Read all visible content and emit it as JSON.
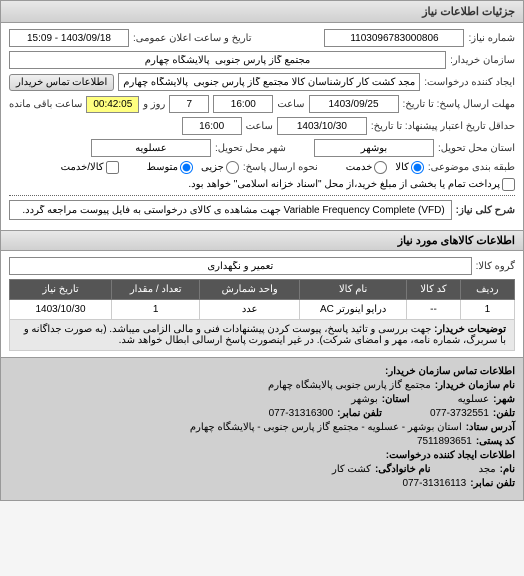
{
  "header": {
    "title": "جزئیات اطلاعات نیاز"
  },
  "fields": {
    "request_no_label": "شماره نیاز:",
    "request_no": "1103096783000806",
    "pub_date_label": "تاریخ و ساعت اعلان عمومی:",
    "pub_date": "1403/09/18 - 15:09",
    "buyer_org_label": "سازمان خریدار:",
    "buyer_org": "مجتمع گاز پارس جنوبی  پالایشگاه چهارم",
    "creator_label": "ایجاد کننده درخواست:",
    "creator": "مجد کشت کار کارشناسان کالا مجتمع گاز پارس جنوبی  پالایشگاه چهارم",
    "contact_btn": "اطلاعات تماس خریدار",
    "deadline_label": "مهلت ارسال پاسخ: تا تاریخ:",
    "deadline_date": "1403/09/25",
    "time_label": "ساعت",
    "deadline_time": "16:00",
    "days_remain": "7",
    "days_label": "روز و",
    "time_remain": "00:42:05",
    "remain_label": "ساعت باقی مانده",
    "validity_label": "حداقل تاریخ اعتبار پیشنهاد: تا تاریخ:",
    "validity_date": "1403/10/30",
    "validity_time": "16:00",
    "delivery_state_label": "استان محل تحویل:",
    "delivery_state": "بوشهر",
    "delivery_city_label": "شهر محل تحویل:",
    "delivery_city": "عسلویه",
    "budget_label": "طبقه بندی موضوعی:",
    "radio_goods": "کالا",
    "radio_service": "خدمت",
    "reply_method_label": "نحوه ارسال پاسخ:",
    "radio_normal": "متوسط",
    "radio_partial": "جزیی",
    "sms_checkbox": "کالا/خدمت",
    "credit_note": "پرداخت تمام یا بخشی از مبلغ خرید،از محل \"اسناد خزانه اسلامی\" خواهد بود.",
    "desc_label": "شرح کلی نیاز:",
    "desc": "Variable Frequency Complete (VFD) جهت مشاهده ی کالای درخواستی به فایل پیوست مراجعه گردد."
  },
  "goods_section": {
    "title": "اطلاعات کالاهای مورد نیاز",
    "group_label": "گروه کالا:",
    "group": "تعمیر و نگهداری"
  },
  "table": {
    "headers": [
      "ردیف",
      "کد کالا",
      "نام کالا",
      "واحد شمارش",
      "تعداد / مقدار",
      "تاریخ نیاز"
    ],
    "rows": [
      {
        "row": "1",
        "code": "--",
        "name": "درایو اینورتر AC",
        "unit": "عدد",
        "qty": "1",
        "date": "1403/10/30"
      }
    ],
    "notes_label": "توضیحات خریدار:",
    "notes": "جهت بررسی و تائید پاسخ، پیوست کردن پیشنهادات فنی و مالی الزامی میباشد. (به صورت جداگانه و با سربرگ، شماره نامه، مهر و امضای شرکت). در غیر اینصورت پاسخ ارسالی ابطال خواهد شد."
  },
  "contact": {
    "title": "اطلاعات تماس سازمان خریدار:",
    "org_label": "نام سازمان خریدار:",
    "org": "مجتمع گاز پارس جنوبی پالایشگاه چهارم",
    "city_label": "شهر:",
    "city": "عسلویه",
    "state_label": "استان:",
    "state": "بوشهر",
    "phone_label": "تلفن:",
    "phone": "077-3732551",
    "fax_label": "تلفن نمابر:",
    "fax": "077-31316300",
    "address_label": "آدرس ستاد:",
    "address": "استان بوشهر - عسلویه - مجتمع گاز پارس جنوبی - پالایشگاه چهارم",
    "postal_label": "کد پستی:",
    "postal": "7511893651",
    "creator_title": "اطلاعات ایجاد کننده درخواست:",
    "creator_name_label": "نام:",
    "creator_name": "مجد",
    "creator_family_label": "نام خانوادگی:",
    "creator_family": "کشت کار",
    "creator_fax_label": "تلفن نمابر:",
    "creator_fax": "077-31316113"
  }
}
